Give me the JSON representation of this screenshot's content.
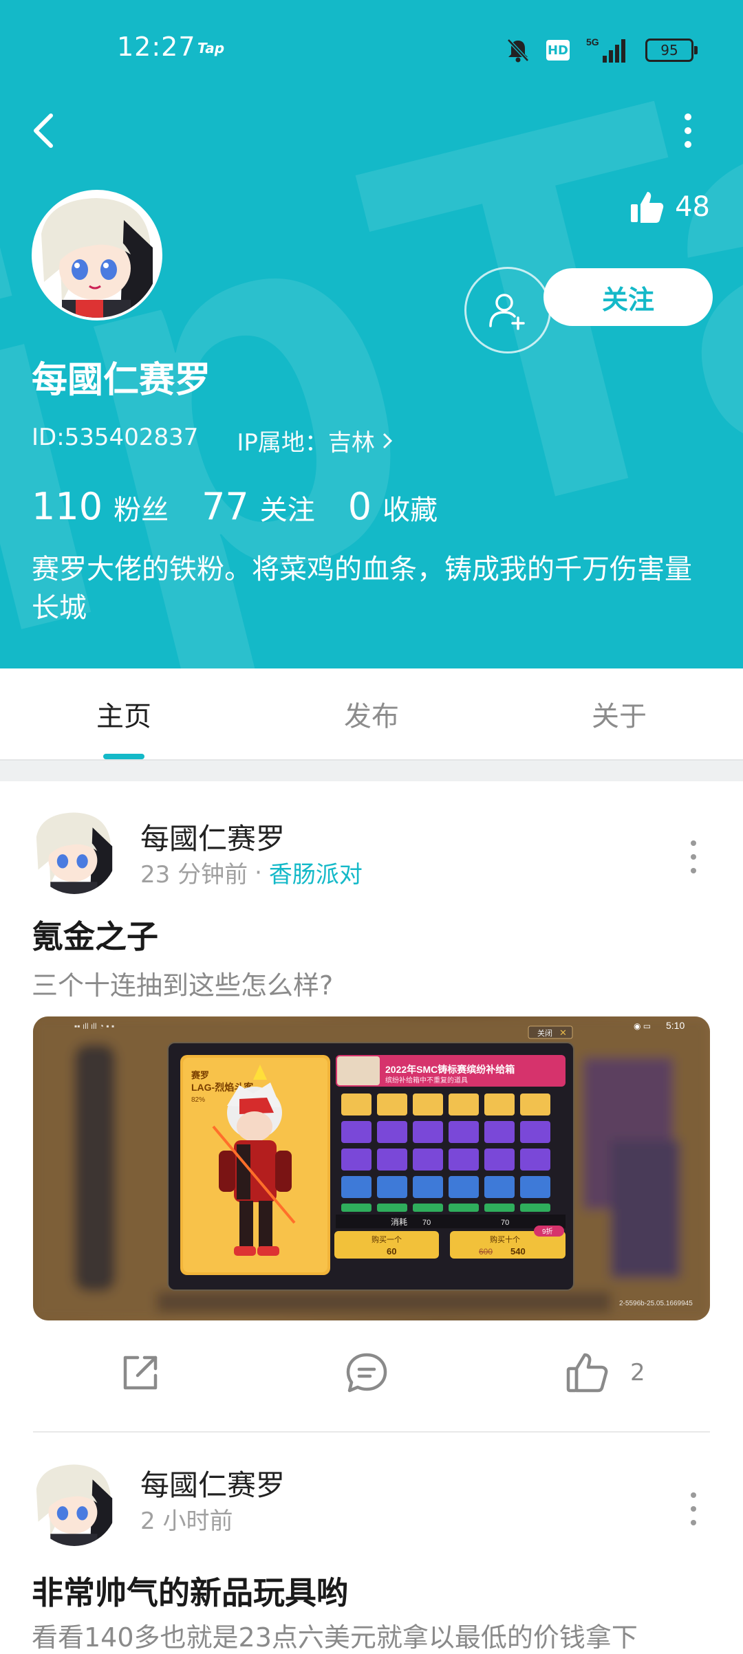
{
  "status": {
    "time": "12:27",
    "tap_label": "Tap",
    "network": "5G",
    "battery": "95"
  },
  "colors": {
    "accent": "#14b9c8"
  },
  "profile": {
    "likes": "48",
    "follow_label": "关注",
    "name": "每國仁赛罗",
    "id_text": "ID:535402837",
    "ip_text": "IP属地：吉林",
    "stats": [
      {
        "num": "110",
        "label": "粉丝"
      },
      {
        "num": "77",
        "label": "关注"
      },
      {
        "num": "0",
        "label": "收藏"
      }
    ],
    "bio": "赛罗大佬的铁粉。将菜鸡的血条，铸成我的千万伤害量长城"
  },
  "tabs": [
    "主页",
    "发布",
    "关于"
  ],
  "posts": [
    {
      "author": "每國仁赛罗",
      "time": "23 分钟前",
      "separator": "·",
      "game": "香肠派对",
      "title": "氪金之子",
      "desc": "三个十连抽到这些怎么样?",
      "image": {
        "status_time": "5:10",
        "close_label": "关闭",
        "banner": "2022年SMC铸标赛缤纷补给箱",
        "banner_sub": "缤纷补给箱中不重复的道具",
        "char_label": "赛罗",
        "char_name": "LAG-烈焰斗客",
        "rate": "82%",
        "cost_label": "消耗",
        "cost_a": "70",
        "cost_b": "70",
        "buy_one_label": "购买一个",
        "buy_one_price": "60",
        "buy_ten_label": "购买十个",
        "buy_ten_old": "600",
        "buy_ten_price": "540",
        "discount": "9折",
        "watermark": "2-5596b-25.05.1669945"
      },
      "likes": "2"
    },
    {
      "author": "每國仁赛罗",
      "time": "2 小时前",
      "title": "非常帅气的新品玩具哟",
      "desc": "看看140多也就是23点六美元就拿以最低的价钱拿下"
    }
  ]
}
